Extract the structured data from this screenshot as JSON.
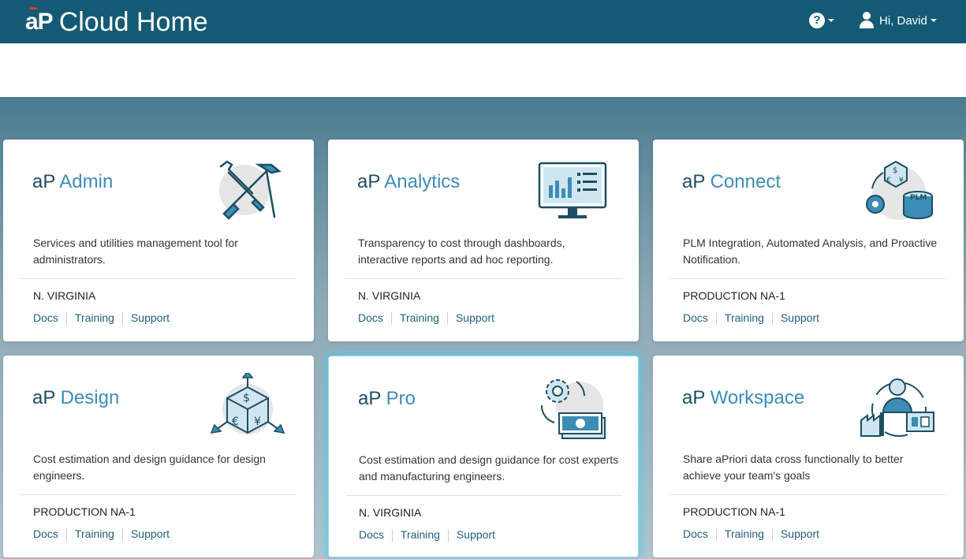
{
  "header": {
    "logo_text": "aP",
    "title": "Cloud Home",
    "help_icon": "question-circle-icon",
    "help_label": "?",
    "user_greeting": "Hi, David",
    "user_icon": "user-icon"
  },
  "colors": {
    "header_bg": "#145a74",
    "title_prefix": "#1c4e63",
    "title_name": "#3c8db5",
    "link": "#1f5f7d"
  },
  "cards": [
    {
      "prefix": "aP",
      "name": "Admin",
      "icon": "wrench-screwdriver-hammer-icon",
      "description": "Services and utilities management tool for administrators.",
      "region": "N. VIRGINIA",
      "links": [
        "Docs",
        "Training",
        "Support"
      ]
    },
    {
      "prefix": "aP",
      "name": "Analytics",
      "icon": "dashboard-monitor-icon",
      "description": "Transparency to cost through dashboards, interactive reports and ad hoc reporting.",
      "region": "N. VIRGINIA",
      "links": [
        "Docs",
        "Training",
        "Support"
      ]
    },
    {
      "prefix": "aP",
      "name": "Connect",
      "icon": "plm-connect-icon",
      "icon_text": "PLM",
      "description": "PLM Integration, Automated Analysis, and Proactive Notification.",
      "region": "PRODUCTION NA-1",
      "links": [
        "Docs",
        "Training",
        "Support"
      ]
    },
    {
      "prefix": "aP",
      "name": "Design",
      "icon": "currency-cube-icon",
      "description": "Cost estimation and design guidance for design engineers.",
      "region": "PRODUCTION NA-1",
      "links": [
        "Docs",
        "Training",
        "Support"
      ]
    },
    {
      "prefix": "aP",
      "name": "Pro",
      "icon": "gear-money-icon",
      "description": "Cost estimation and design guidance for cost experts and manufacturing engineers.",
      "region": "N. VIRGINIA",
      "links": [
        "Docs",
        "Training",
        "Support"
      ],
      "highlighted": true
    },
    {
      "prefix": "aP",
      "name": "Workspace",
      "icon": "person-factory-icon",
      "description": "Share aPriori data cross functionally to better achieve your team's goals",
      "region": "PRODUCTION NA-1",
      "links": [
        "Docs",
        "Training",
        "Support"
      ]
    }
  ]
}
